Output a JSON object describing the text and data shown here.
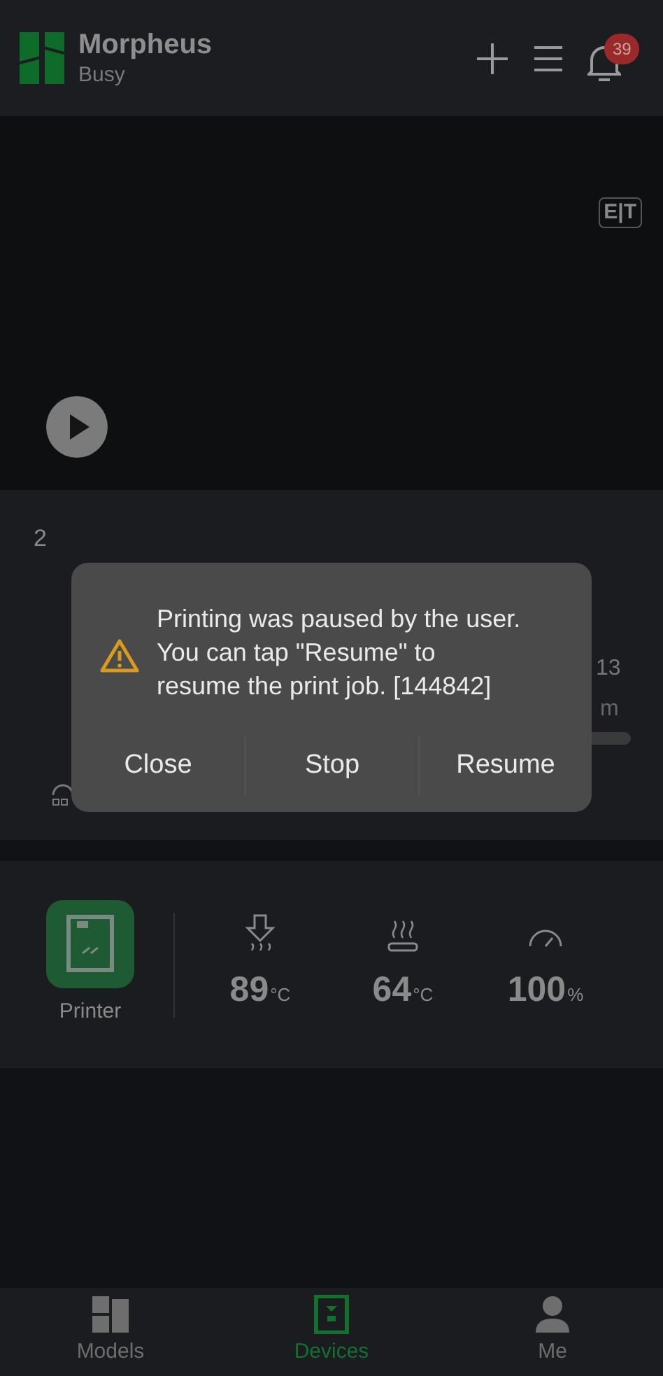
{
  "header": {
    "title": "Morpheus",
    "status": "Busy",
    "notification_count": "39"
  },
  "camera": {
    "mode_badge": "E|T"
  },
  "job": {
    "plate_number": "2",
    "value_1": "13",
    "value_2": "m"
  },
  "stats": {
    "device_label": "Printer",
    "readings": [
      {
        "kind": "nozzle",
        "value": "89",
        "unit": "°C"
      },
      {
        "kind": "bed",
        "value": "64",
        "unit": "°C"
      },
      {
        "kind": "speed",
        "value": "100",
        "unit": "%"
      }
    ]
  },
  "dialog": {
    "message": "Printing was paused by the user. You can tap \"Resume\" to resume the print job. [144842]",
    "buttons": [
      "Close",
      "Stop",
      "Resume"
    ]
  },
  "nav": [
    {
      "kind": "models",
      "label": "Models",
      "selected": false
    },
    {
      "kind": "devices",
      "label": "Devices",
      "selected": true
    },
    {
      "kind": "me",
      "label": "Me",
      "selected": false
    }
  ]
}
